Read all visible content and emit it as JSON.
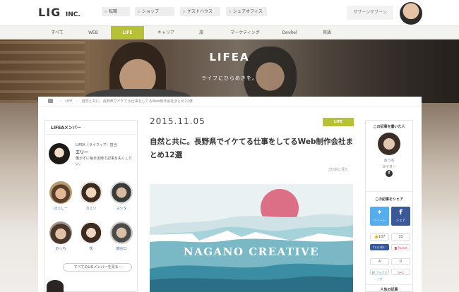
{
  "header": {
    "logo_main": "LIG",
    "logo_suffix": "INC.",
    "buttons": [
      {
        "icon": "search-icon",
        "label": "転職"
      },
      {
        "icon": "search-icon",
        "label": "ショップ"
      },
      {
        "icon": "search-icon",
        "label": "ゲストハウス"
      },
      {
        "icon": "search-icon",
        "label": "シェアオフィス"
      }
    ],
    "search_placeholder": "ザブーンザブーン"
  },
  "nav": {
    "items": [
      "すべて",
      "WEB",
      "LIFE",
      "キャリア",
      "旅",
      "マーケティング",
      "DevRel",
      "英語"
    ],
    "active": "LIFE"
  },
  "hero": {
    "title": "LIFEA",
    "subtitle": "ライフにひらめきを。"
  },
  "breadcrumb": {
    "items": [
      "LIFE",
      "自然と共に。長野県でイケてる仕事をしてるWeb制作会社まとめ12選"
    ]
  },
  "sidebar_left": {
    "title": "LIFEAメンバー",
    "featured": {
      "role": "LIFEA（ライフィア）担当",
      "name": "エリー",
      "desc": "働かずに毎日定時で記事を失くしたい。"
    },
    "members": [
      {
        "name": "ほっしー"
      },
      {
        "name": "カエリ"
      },
      {
        "name": "ヨシタ"
      },
      {
        "name": "のっち"
      },
      {
        "name": "枕"
      },
      {
        "name": "錦古口"
      }
    ],
    "all_members_label": "すべてのLIGメンバーを見る"
  },
  "article": {
    "date": "2015.11.05",
    "category": "LIFE",
    "title": "自然と共に。長野県でイケてる仕事をしてるWeb制作会社まとめ12選",
    "read_time": "3分前に見た",
    "image_text": "NAGANO CREATIVE"
  },
  "sidebar_right": {
    "author_title": "この記事を書いた人",
    "author_name": "のっち",
    "author_role": "ライター",
    "share_title": "この記事をシェア",
    "tweet_label": "ツイート",
    "share_label": "シェア",
    "counts": {
      "likes": "107",
      "shares": "32",
      "pocket": "0",
      "hatena": "4"
    },
    "likes_label": "いいね！",
    "pocket_label": "Pocket",
    "hatena_label": "ブックマーク",
    "gplus_label": "G+1",
    "bottom_title": "人気の記事"
  },
  "colors": {
    "accent": "#b6c137",
    "twitter": "#55acee",
    "facebook": "#3b5998"
  }
}
